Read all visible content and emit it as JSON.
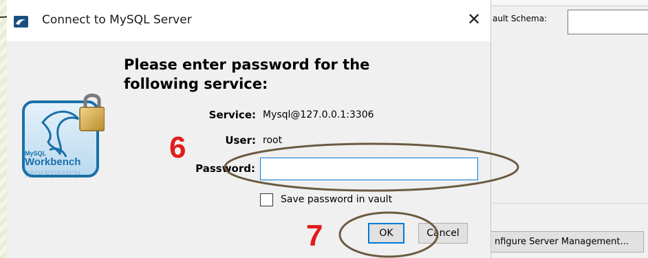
{
  "dialog": {
    "title": "Connect to MySQL Server",
    "close_glyph": "✕",
    "heading_line1": "Please enter password for the",
    "heading_line2": "following service:",
    "service_label": "Service:",
    "service_value": "Mysql@127.0.0.1:3306",
    "user_label": "User:",
    "user_value": "root",
    "password_label": "Password:",
    "password_value": "",
    "save_password_label": "Save password in vault",
    "save_password_checked": false,
    "ok_label": "OK",
    "cancel_label": "Cancel",
    "logo": {
      "line1": "MySQL",
      "line2": "Workbench",
      "line3": "Workbench"
    }
  },
  "background_window": {
    "schema_label": "ault Schema:",
    "schema_value": "",
    "configure_button_label": "nfigure Server Management..."
  },
  "annotations": {
    "step_6": "6",
    "step_7": "7"
  },
  "icons": {
    "title_icon": "mysql-workbench-icon",
    "close_icon": "close-icon",
    "logo": "mysql-workbench-logo",
    "lock": "padlock-icon"
  },
  "colors": {
    "accent": "#0078d7",
    "annotation_number": "#e21b1b",
    "annotation_ellipse": "#6b5a40",
    "logo_blue": "#1b6fa8"
  }
}
